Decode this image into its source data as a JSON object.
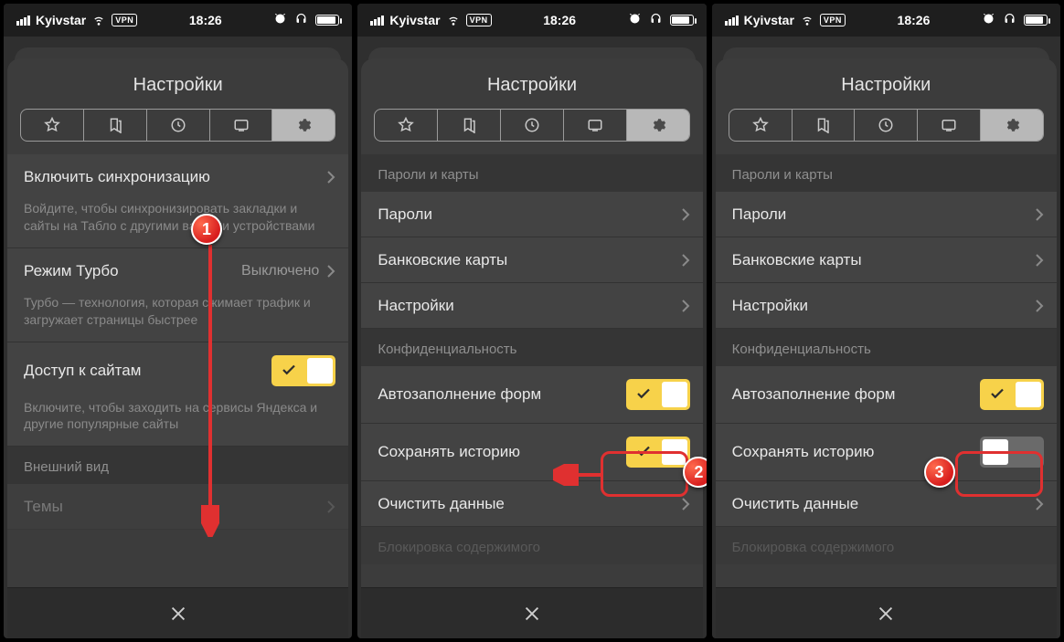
{
  "statusbar": {
    "carrier": "Kyivstar",
    "vpn": "VPN",
    "time": "18:26"
  },
  "title": "Настройки",
  "icons": {
    "star": "star-icon",
    "bookmark": "bookmark-icon",
    "clock": "clock-icon",
    "monitor": "monitor-icon",
    "gear": "gear-icon"
  },
  "screen1": {
    "sync": {
      "label": "Включить синхронизацию",
      "sub": "Войдите, чтобы синхронизировать закладки и сайты на Табло с другими вашими устройствами"
    },
    "turbo": {
      "label": "Режим Турбо",
      "value": "Выключено",
      "sub": "Турбо — технология, которая сжимает трафик и загружает страницы быстрее"
    },
    "access": {
      "label": "Доступ к сайтам",
      "sub": "Включите, чтобы заходить на сервисы Яндекса и другие популярные сайты"
    },
    "appearance_header": "Внешний вид",
    "themes": "Темы"
  },
  "screen23": {
    "pwd_header": "Пароли и карты",
    "passwords": "Пароли",
    "cards": "Банковские карты",
    "settings": "Настройки",
    "privacy_header": "Конфиденциальность",
    "autofill": "Автозаполнение форм",
    "history": "Сохранять историю",
    "clear": "Очистить данные",
    "block_header": "Блокировка содержимого"
  },
  "badges": {
    "b1": "1",
    "b2": "2",
    "b3": "3"
  }
}
